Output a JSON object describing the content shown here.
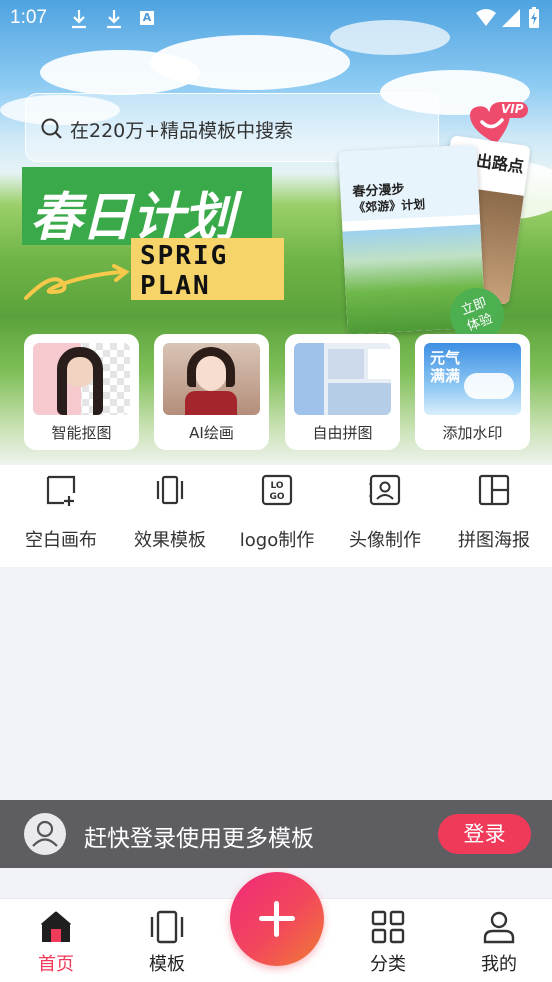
{
  "status_bar": {
    "time": "1:07",
    "a_badge": "A"
  },
  "search": {
    "placeholder": "在220万+精品模板中搜索"
  },
  "vip_badge": "VIP",
  "banner": {
    "title_cn": "春日计划",
    "title_en_line1": "SPRIG",
    "title_en_line2": "PLAN",
    "poster_line1": "春分漫步",
    "poster_line2": "《郊游》计划",
    "poster_side": "出路点",
    "try_label_1": "立即",
    "try_label_2": "体验"
  },
  "feature_cards": [
    {
      "label": "智能抠图"
    },
    {
      "label": "AI绘画"
    },
    {
      "label": "自由拼图"
    },
    {
      "label": "添加水印",
      "thumb_text": "元气满满"
    }
  ],
  "tools": [
    {
      "label": "空白画布",
      "icon": "blank-canvas-icon"
    },
    {
      "label": "效果模板",
      "icon": "template-icon"
    },
    {
      "label": "logo制作",
      "icon": "logo-icon"
    },
    {
      "label": "头像制作",
      "icon": "avatar-make-icon"
    },
    {
      "label": "拼图海报",
      "icon": "collage-icon"
    }
  ],
  "login_banner": {
    "message": "赶快登录使用更多模板",
    "button": "登录"
  },
  "bottom_nav": [
    {
      "label": "首页",
      "active": true
    },
    {
      "label": "模板",
      "active": false
    },
    {
      "label": "分类",
      "active": false
    },
    {
      "label": "我的",
      "active": false
    }
  ],
  "colors": {
    "accent": "#f03a5a",
    "active_nav": "#f03a5a",
    "banner_gray": "#5e5e62"
  }
}
